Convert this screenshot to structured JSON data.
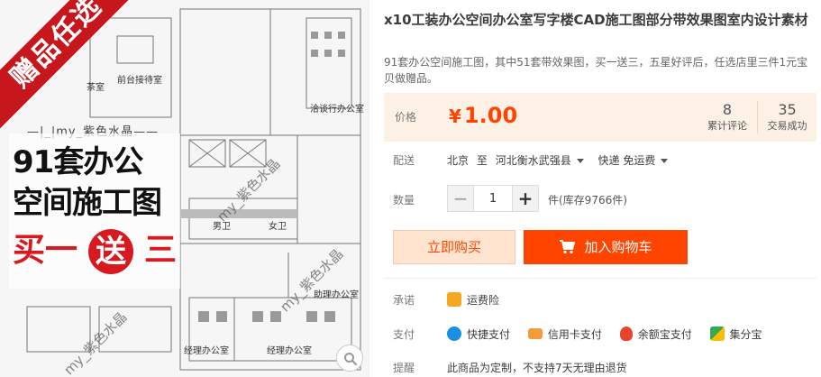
{
  "gallery": {
    "ribbon": "赠品任选",
    "watermark": "my_紫色水晶",
    "poster_topline": "—|_|my_紫色水晶——",
    "poster_line1": "91套办公",
    "poster_line2": "空间施工图",
    "poster_buy": "买一",
    "poster_send": "送",
    "poster_three": "三",
    "room_labels": [
      "茶室",
      "前台接待室",
      "洽谈行办公室",
      "男卫",
      "女卫",
      "助理办公室",
      "经理办公室",
      "经理办公室"
    ],
    "zoom_icon": "magnifier-icon"
  },
  "product": {
    "title": "x10工装办公空间办公室写字楼CAD施工图部分带效果图室内设计素材",
    "subtitle": "91套办公空间施工图，其中51套带效果图，买一送三，五星好评后，任选店里三件1元宝贝做赠品。"
  },
  "price": {
    "label": "价格",
    "currency": "¥",
    "value": "1.00",
    "reviews_count": "8",
    "reviews_label": "累计评论",
    "deals_count": "35",
    "deals_label": "交易成功"
  },
  "delivery": {
    "label": "配送",
    "from": "北京",
    "to_word": "至",
    "destination": "河北衡水武强县",
    "shipping": "快递 免运费"
  },
  "quantity": {
    "label": "数量",
    "value": "1",
    "minus": "−",
    "plus": "+",
    "unit_stock": "件(库存9766件)"
  },
  "actions": {
    "buy_now": "立即购买",
    "add_cart": "加入购物车"
  },
  "promise": {
    "label": "承诺",
    "items": [
      {
        "icon": "freight-insurance-icon",
        "text": "运费险"
      }
    ]
  },
  "payment": {
    "label": "支付",
    "items": [
      {
        "icon": "quick-pay-icon",
        "text": "快捷支付"
      },
      {
        "icon": "credit-card-icon",
        "text": "信用卡支付"
      },
      {
        "icon": "yuebao-icon",
        "text": "余额宝支付"
      },
      {
        "icon": "jifenbao-icon",
        "text": "集分宝"
      }
    ]
  },
  "notice": {
    "label": "提醒",
    "text": "此商品为定制，不支持7天无理由退货"
  },
  "colors": {
    "accent": "#ff4400",
    "price_bg": "#fdf0e5",
    "buy_bg": "#ffe4d0",
    "ribbon": "#c8161d"
  }
}
